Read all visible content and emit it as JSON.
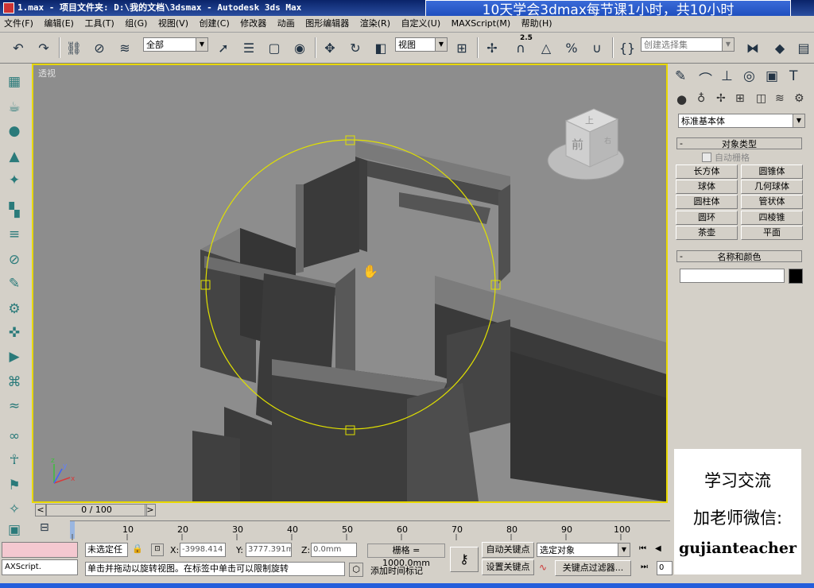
{
  "window": {
    "title": "1.max    - 项目文件夹: D:\\我的文档\\3dsmax    - Autodesk 3ds Max",
    "overlay_banner": "10天学会3dmax每节课1小时，共10小时"
  },
  "menu": [
    "文件(F)",
    "编辑(E)",
    "工具(T)",
    "组(G)",
    "视图(V)",
    "创建(C)",
    "修改器",
    "动画",
    "图形编辑器",
    "渲染(R)",
    "自定义(U)",
    "MAXScript(M)",
    "帮助(H)"
  ],
  "toolbar": {
    "selection_filter": "全部",
    "ref_coord": "视图",
    "named_selection_placeholder": "创建选择集",
    "snap_angle_label": "2.5"
  },
  "viewport": {
    "label": "透视",
    "viewcube_top": "上",
    "viewcube_front": "前",
    "viewcube_right": "右",
    "axis_x": "x",
    "axis_y": "y",
    "axis_z": "z"
  },
  "command_panel": {
    "category_dropdown": "标准基本体",
    "object_type_title": "对象类型",
    "auto_grid": "自动栅格",
    "buttons": [
      "长方体",
      "圆锥体",
      "球体",
      "几何球体",
      "圆柱体",
      "管状体",
      "圆环",
      "四棱锥",
      "茶壶",
      "平面"
    ],
    "name_color_title": "名称和颜色",
    "name_value": "",
    "color": "#000000"
  },
  "timeline": {
    "frame_indicator": "0 / 100",
    "ticks": [
      "10",
      "20",
      "30",
      "40",
      "50",
      "60",
      "70",
      "80",
      "90",
      "100"
    ]
  },
  "status": {
    "maxscript": "AXScript.",
    "selection_state": "未选定任",
    "x_label": "X:",
    "x_value": "-3998.414",
    "y_label": "Y:",
    "y_value": "3777.391m",
    "z_label": "Z:",
    "z_value": "0.0mm",
    "grid": "栅格 = 1000.0mm",
    "auto_key": "自动关键点",
    "set_key": "设置关键点",
    "key_mode_select": "选定对象",
    "key_filters": "关键点过滤器...",
    "add_time_tag": "添加时间标记",
    "prompt": "单击并拖动以旋转视图。在标签中单击可以限制旋转",
    "frame_field": "0"
  },
  "watermark": {
    "line1": "学习交流",
    "line2": "加老师微信:",
    "line3": "gujianteacher"
  },
  "colors": {
    "viewport_bg": "#8d8d8d",
    "viewport_border": "#e8d800",
    "orbit_ring": "#e0e000",
    "titlebar": "#0a246a",
    "banner": "#2a5bd0",
    "walls_dark": "#3e3e3e",
    "walls_top": "#7a7a7a"
  }
}
